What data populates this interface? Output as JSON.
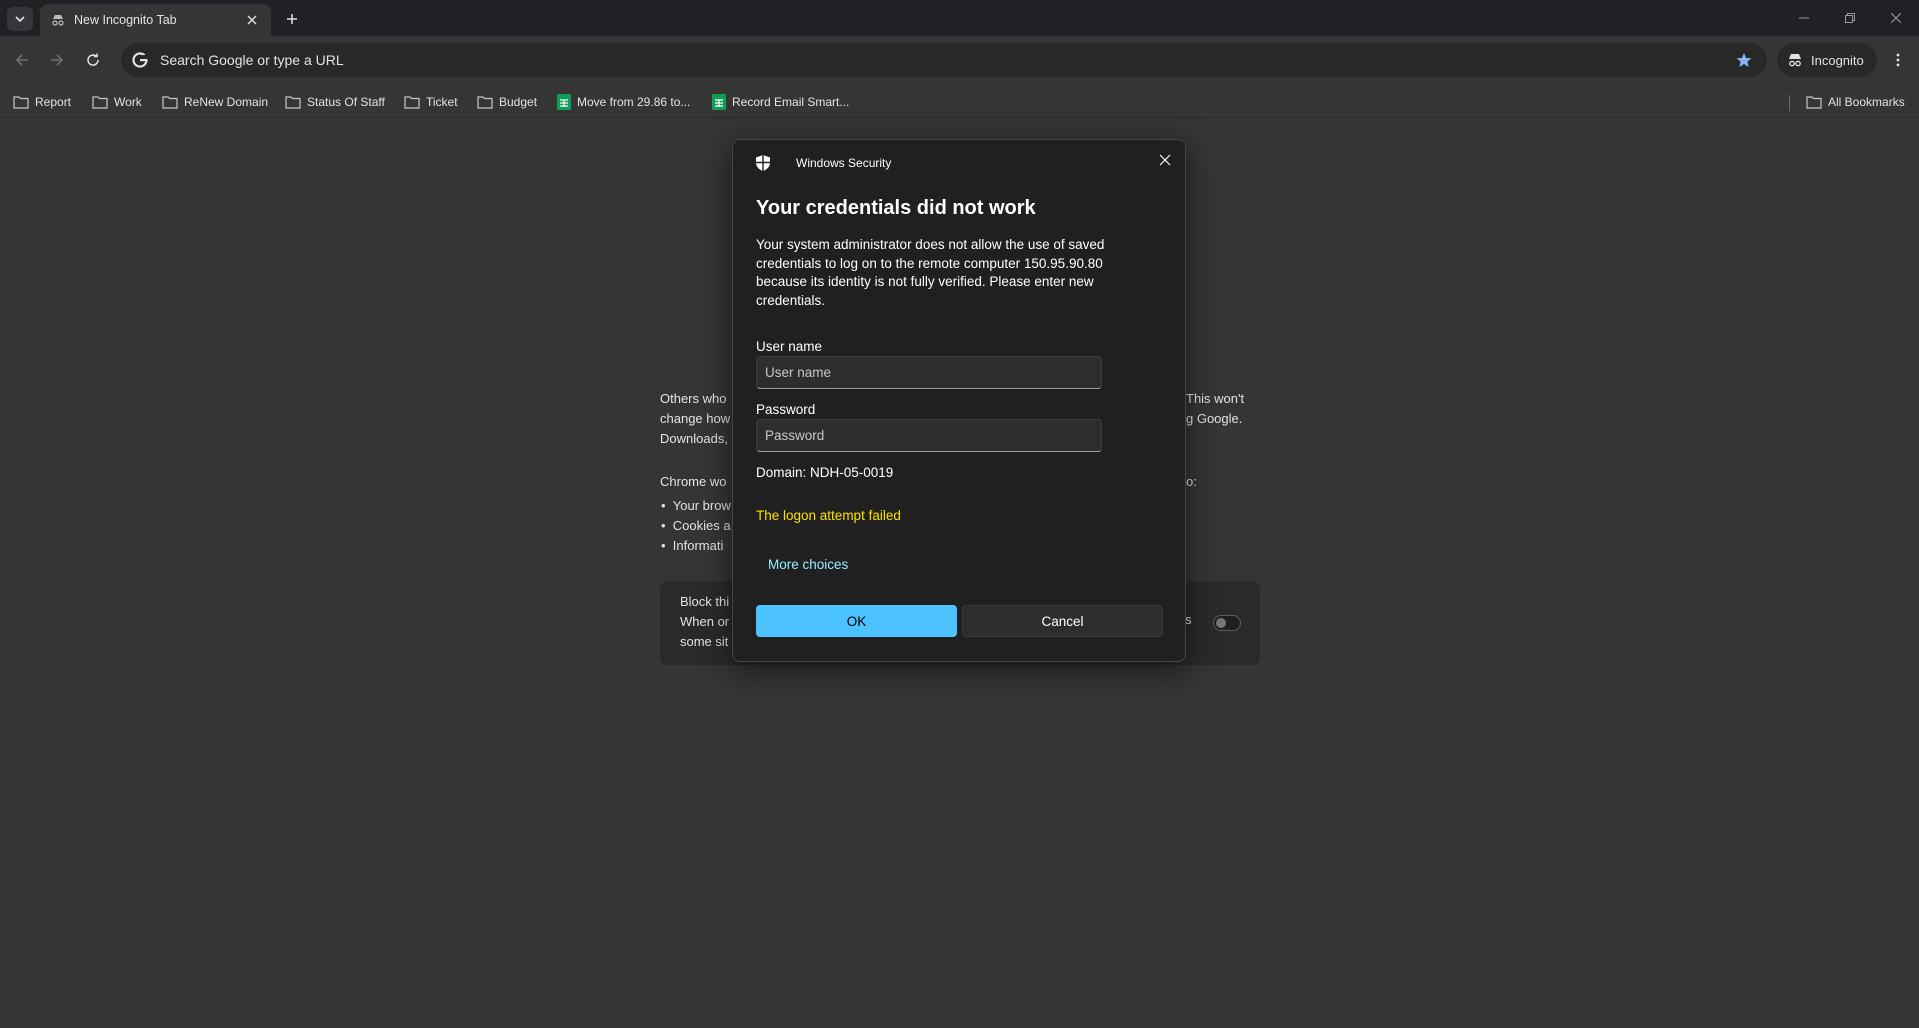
{
  "tab": {
    "title": "New Incognito Tab"
  },
  "omnibox": {
    "placeholder": "Search Google or type a URL"
  },
  "profile": {
    "label": "Incognito"
  },
  "bookmarks": [
    {
      "label": "Report",
      "type": "folder"
    },
    {
      "label": "Work",
      "type": "folder"
    },
    {
      "label": "ReNew Domain",
      "type": "folder"
    },
    {
      "label": "Status Of Staff",
      "type": "folder"
    },
    {
      "label": "Ticket",
      "type": "folder"
    },
    {
      "label": "Budget",
      "type": "folder"
    },
    {
      "label": "Move from 29.86 to...",
      "type": "sheet"
    },
    {
      "label": "Record Email Smart...",
      "type": "sheet"
    }
  ],
  "all_bookmarks": "All Bookmarks",
  "background": {
    "p1_left": "Others who",
    "p1_right": "This won't",
    "p2_left": "change how",
    "p2_right": "g Google.",
    "p3_left": "Downloads,",
    "p4_left": "Chrome wo",
    "p4_right": "o:",
    "bullets": [
      "Your brow",
      "Cookies a",
      "Informati"
    ],
    "card_lines": [
      "Block thi",
      "When or",
      "some sit"
    ],
    "card_right": "s"
  },
  "dialog": {
    "app_name": "Windows Security",
    "title": "Your credentials did not work",
    "message": "Your system administrator does not allow the use of saved credentials to log on to the remote computer 150.95.90.80 because its identity is not fully verified. Please enter new credentials.",
    "username_label": "User name",
    "username_placeholder": "User name",
    "password_label": "Password",
    "password_placeholder": "Password",
    "domain": "Domain: NDH-05-0019",
    "error": "The logon attempt failed",
    "more_choices": "More choices",
    "ok_label": "OK",
    "cancel_label": "Cancel"
  },
  "colors": {
    "accent": "#4cc2ff",
    "error": "#fce100",
    "link": "#99ebff",
    "star": "#8ab4f8"
  }
}
